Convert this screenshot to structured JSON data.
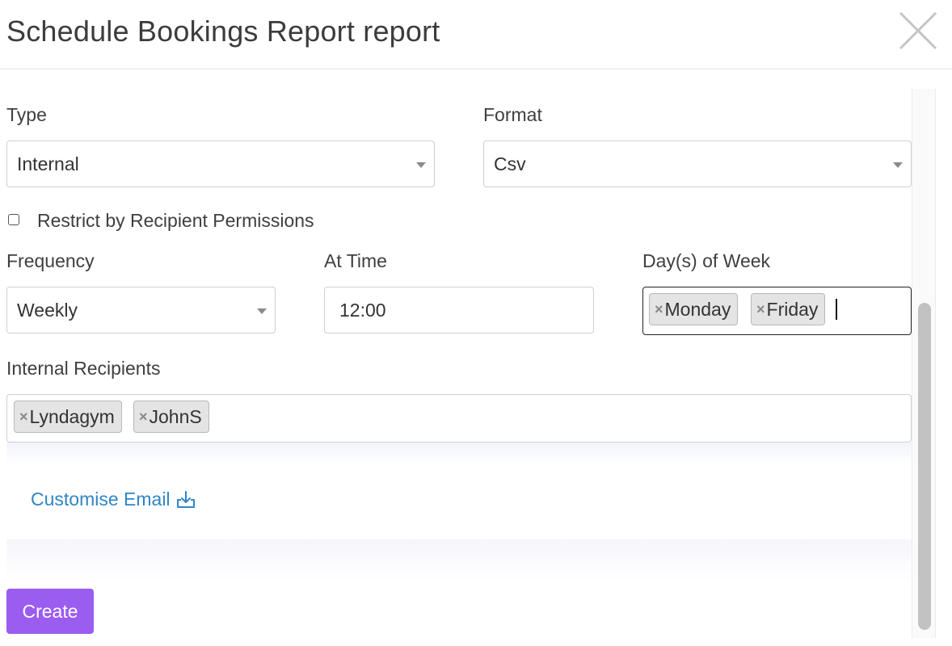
{
  "header": {
    "title": "Schedule Bookings Report report",
    "close_icon": "close-icon"
  },
  "form": {
    "type": {
      "label": "Type",
      "value": "Internal"
    },
    "format": {
      "label": "Format",
      "value": "Csv"
    },
    "restrict": {
      "label": "Restrict by Recipient Permissions",
      "checked": false
    },
    "frequency": {
      "label": "Frequency",
      "value": "Weekly"
    },
    "at_time": {
      "label": "At Time",
      "value": "12:00"
    },
    "days": {
      "label": "Day(s) of Week",
      "tags": [
        "Monday",
        "Friday"
      ],
      "remove_glyph": "×"
    },
    "recipients": {
      "label": "Internal Recipients",
      "tags": [
        "Lyndagym",
        "JohnS"
      ],
      "remove_glyph": "×"
    }
  },
  "customise_email": {
    "label": "Customise Email",
    "icon": "download-icon",
    "color": "#2f86c4"
  },
  "actions": {
    "create_label": "Create",
    "create_color": "#9b5cf0"
  }
}
